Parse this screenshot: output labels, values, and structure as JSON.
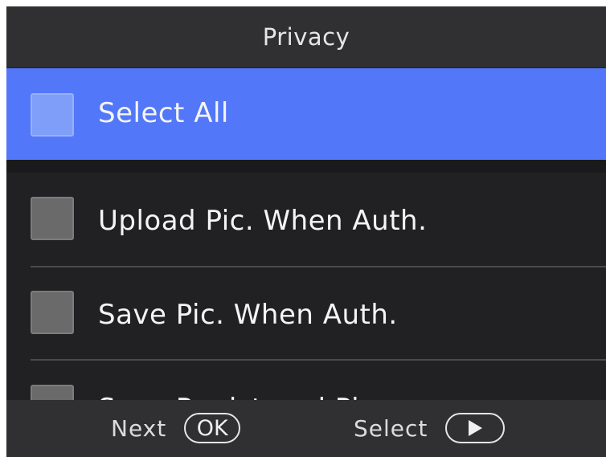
{
  "header": {
    "title": "Privacy"
  },
  "select_all": {
    "label": "Select All",
    "checked": false
  },
  "items": [
    {
      "label": "Upload Pic. When Auth.",
      "checked": false
    },
    {
      "label": "Save Pic. When Auth.",
      "checked": false
    },
    {
      "label": "Save Registered Pic.",
      "checked": false
    }
  ],
  "footer": {
    "next_label": "Next",
    "ok_key": "OK",
    "select_label": "Select",
    "select_key_icon": "play-icon"
  },
  "colors": {
    "highlight": "#5277f8",
    "background": "#212124",
    "bar": "#303033"
  }
}
